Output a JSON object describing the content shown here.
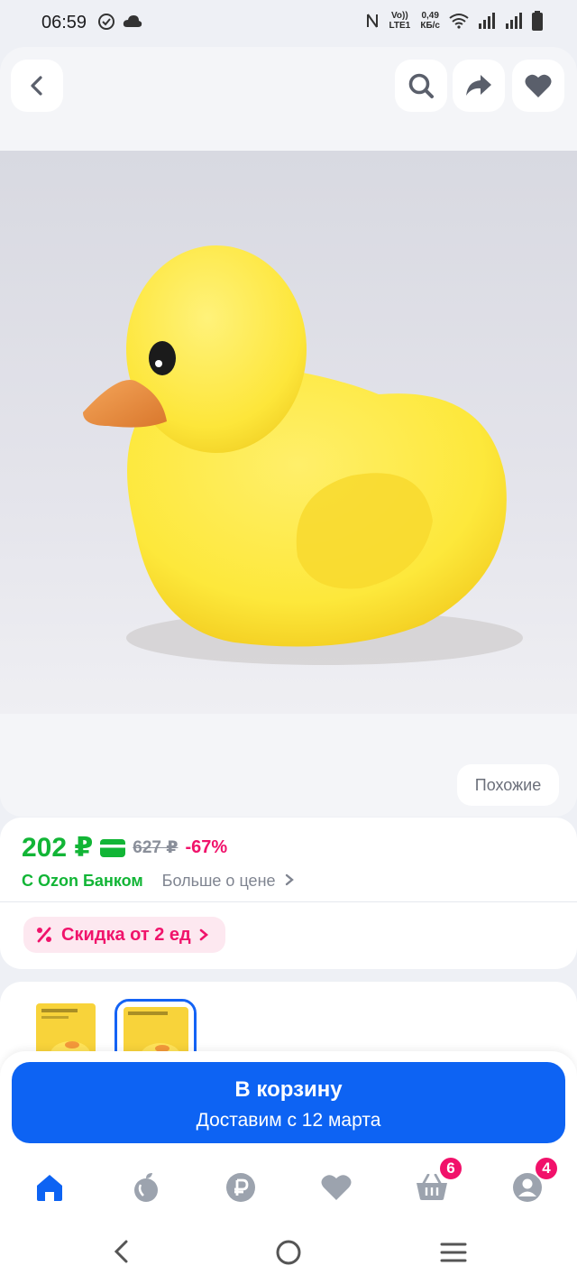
{
  "status_bar": {
    "time": "06:59",
    "volte_label": "Vo)) LTE1",
    "net_speed_value": "0,49",
    "net_speed_unit": "КБ/с",
    "icons": [
      "check-circle-icon",
      "cloud-icon",
      "nfc-icon",
      "wifi-icon",
      "signal-icon",
      "signal-icon",
      "battery-icon"
    ]
  },
  "header": {
    "icons": [
      "back-icon",
      "search-icon",
      "share-icon",
      "heart-icon"
    ]
  },
  "product": {
    "similar_label": "Похожие"
  },
  "price": {
    "current": "202 ₽",
    "old": "627 ₽",
    "discount": "-67%",
    "bank_label": "С Ozon Банком",
    "more_link": "Больше о цене",
    "promo_label": "Скидка от 2 ед",
    "colors": {
      "green": "#12b536",
      "pink": "#f0136b"
    }
  },
  "cart": {
    "title": "В корзину",
    "subtitle": "Доставим с 12 марта",
    "color": "#0d63f3"
  },
  "bottom_nav": {
    "items": [
      {
        "icon": "home-icon",
        "active": true
      },
      {
        "icon": "fresh-icon"
      },
      {
        "icon": "ruble-icon"
      },
      {
        "icon": "favorites-icon"
      },
      {
        "icon": "basket-icon",
        "badge": "6"
      },
      {
        "icon": "profile-icon",
        "badge": "4"
      }
    ]
  },
  "system_nav": {
    "icons": [
      "system-back-icon",
      "system-home-icon",
      "system-recents-icon"
    ]
  }
}
